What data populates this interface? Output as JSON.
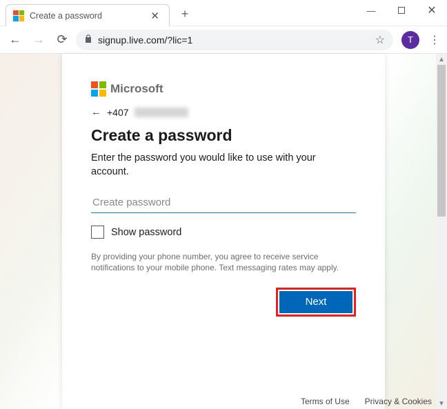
{
  "window": {
    "tab_title": "Create a password",
    "minimize": "—",
    "close": "✕"
  },
  "toolbar": {
    "url": "signup.live.com/?lic=1",
    "avatar_letter": "T"
  },
  "card": {
    "brand": "Microsoft",
    "identity_prefix": "+407",
    "heading": "Create a password",
    "subheading": "Enter the password you would like to use with your account.",
    "password_placeholder": "Create password",
    "show_password_label": "Show password",
    "legal": "By providing your phone number, you agree to receive service notifications to your mobile phone. Text messaging rates may apply.",
    "next_label": "Next"
  },
  "footer": {
    "terms": "Terms of Use",
    "privacy": "Privacy & Cookies"
  }
}
